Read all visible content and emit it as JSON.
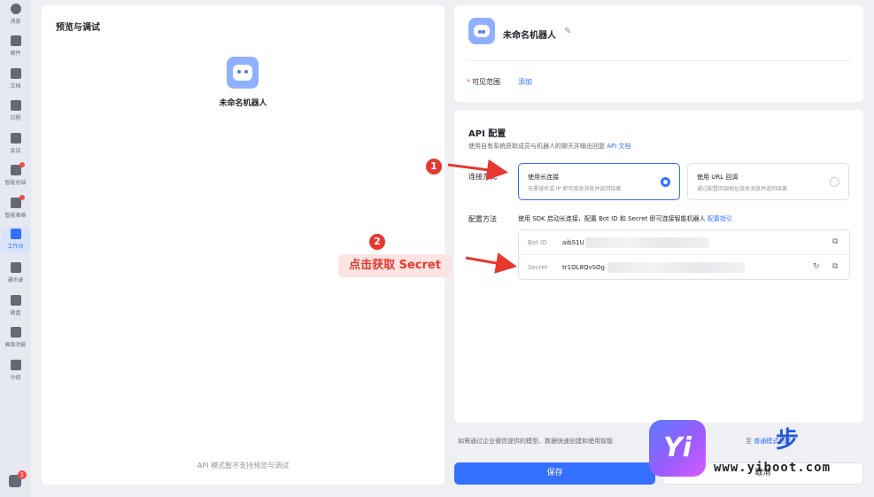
{
  "rail": {
    "items": [
      {
        "label": "消息",
        "active": false
      },
      {
        "label": "邮件",
        "active": false
      },
      {
        "label": "文档",
        "active": false
      },
      {
        "label": "日程",
        "active": false
      },
      {
        "label": "会议",
        "active": false
      },
      {
        "label": "智能总结",
        "active": false,
        "dot": true
      },
      {
        "label": "智能表格",
        "active": false,
        "dot": true
      },
      {
        "label": "工作台",
        "active": true
      },
      {
        "label": "通讯录",
        "active": false
      },
      {
        "label": "微盘",
        "active": false
      },
      {
        "label": "高级功能",
        "active": false
      },
      {
        "label": "分组",
        "active": false
      }
    ],
    "bottom_badge": "1"
  },
  "preview": {
    "title": "预览与调试",
    "bot_name": "未命名机器人",
    "footer": "API 模式暂不支持预览与调试"
  },
  "bot_card": {
    "name": "未命名机器人",
    "edit_icon": "pencil-icon",
    "scope_label": "可见范围",
    "scope_required_mark": "*",
    "scope_action": "添加"
  },
  "api_config": {
    "title": "API 配置",
    "desc": "使用自有系统获取成员与机器人的聊天并输出回复",
    "desc_link": "API 文档",
    "connection_label": "连接方式",
    "options": [
      {
        "title": "使用长连接",
        "subtitle": "无需域名或 IP 即可接收消息并返回结果",
        "selected": true
      },
      {
        "title": "使用 URL 回调",
        "subtitle": "通过配置回调地址接收消息并返回结果",
        "selected": false
      }
    ],
    "config_label": "配置方法",
    "config_desc": "使用 SDK 启动长连接，配置 Bot ID 和 Secret 即可连接智能机器人",
    "config_link": "配置指引",
    "credentials": [
      {
        "key": "Bot ID",
        "value": "aibS1U"
      },
      {
        "key": "Secret",
        "value": "tr1OL8QvSOg"
      }
    ]
  },
  "footnote": {
    "text": "如需通过企业微信提供的模型、数据快速创建和使用智能",
    "text_after": "至",
    "link": "普通模式创建"
  },
  "buttons": {
    "save": "保存",
    "cancel": "取消"
  },
  "annotations": {
    "step1": "1",
    "step2": "2",
    "callout": "点击获取 Secret"
  },
  "watermark": {
    "logo_text": "Yi",
    "step_char": "步",
    "url": "www.yiboot.com"
  },
  "colors": {
    "accent": "#3370ff",
    "annotation_red": "#e7382f",
    "page_bg": "#eef0f4"
  }
}
